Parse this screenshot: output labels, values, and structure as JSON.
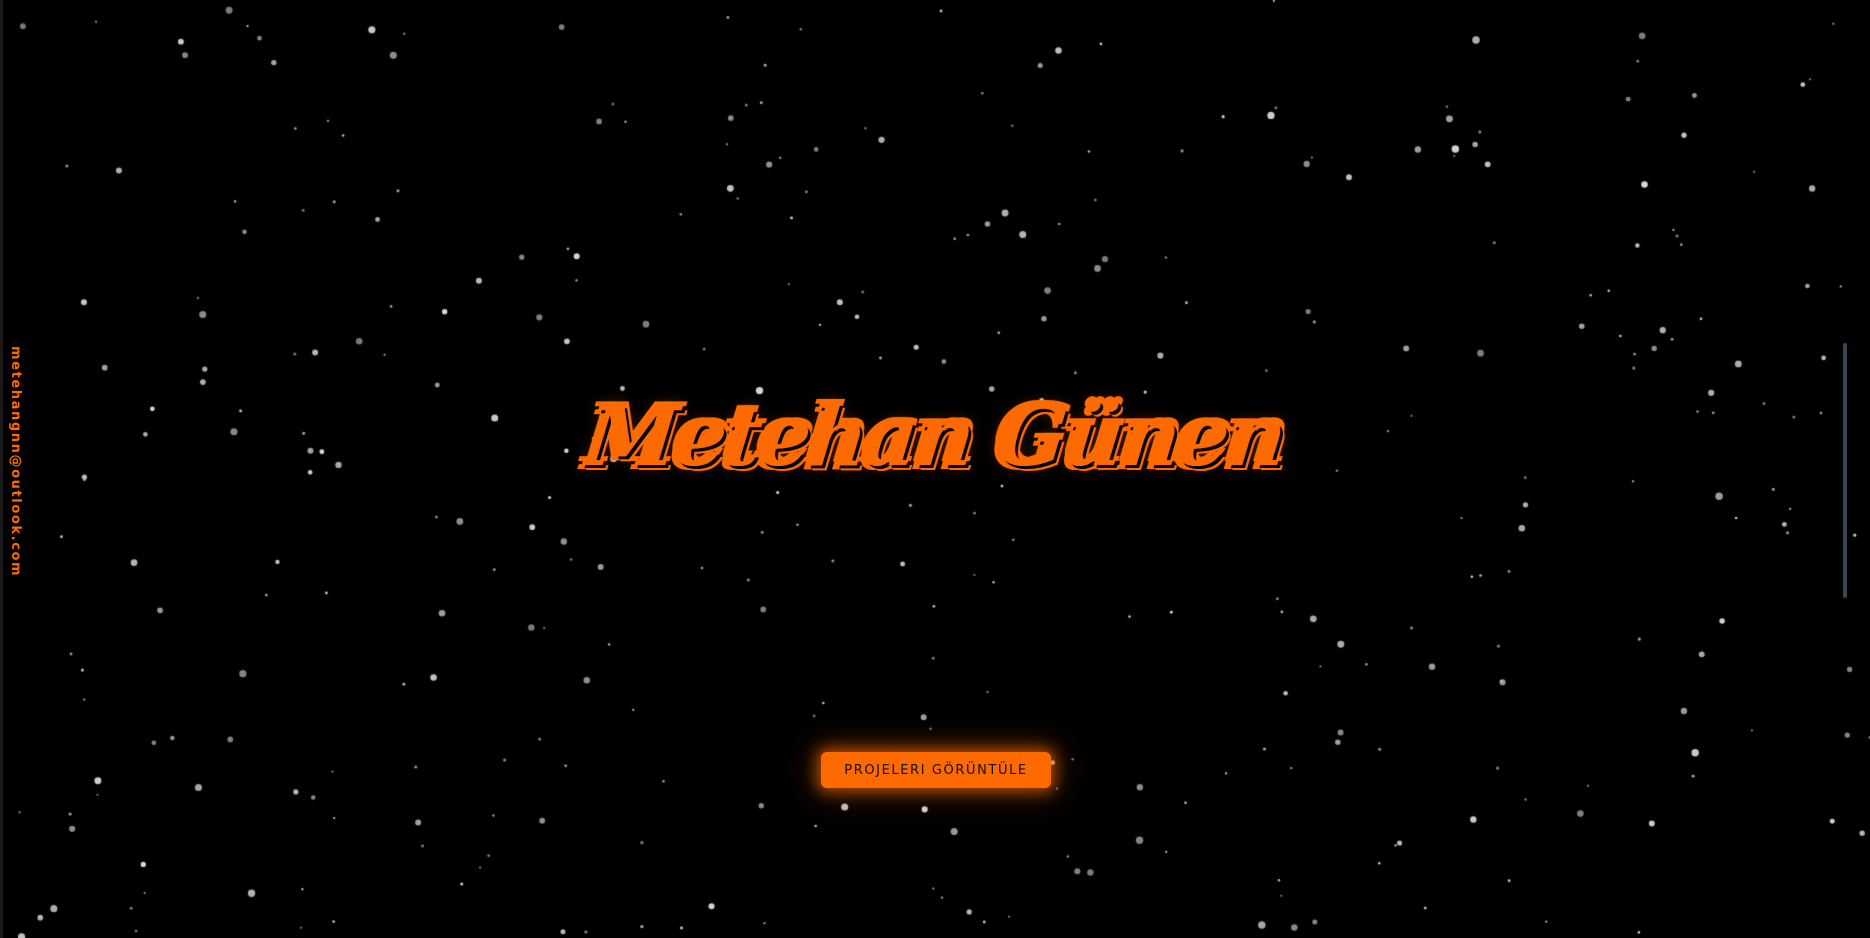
{
  "page": {
    "background_color": "#000000",
    "accent_color": "#ff6a00",
    "star_color": "#d9d9d9"
  },
  "sidebar": {
    "email": "metehangnn@outlook.com"
  },
  "hero": {
    "title": "Metehan Günen",
    "cta_label": "PROJELERI GÖRÜNTÜLE"
  }
}
